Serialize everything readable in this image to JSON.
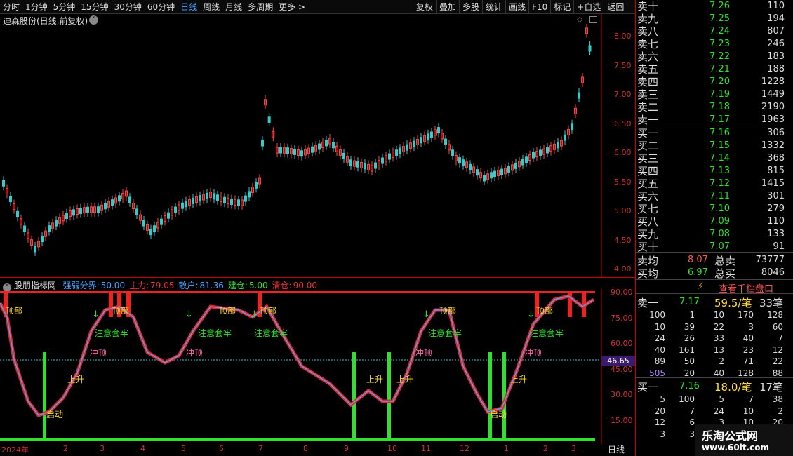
{
  "toolbar": {
    "periods": [
      "分时",
      "1分钟",
      "5分钟",
      "15分钟",
      "30分钟",
      "60分钟",
      "日线",
      "周线",
      "月线",
      "多周期",
      "更多 >"
    ],
    "active": "日线",
    "right": [
      "复权",
      "叠加",
      "多股",
      "统计",
      "画线",
      "F10",
      "标记",
      "+自选",
      "返回"
    ]
  },
  "main_title": "迪森股份(日线,前复权)",
  "price_axis": [
    "8.00",
    "7.50",
    "7.00",
    "6.50",
    "6.00",
    "5.50",
    "5.00",
    "4.50",
    "4.00"
  ],
  "indicator": {
    "name": "股朋指标网",
    "items": [
      {
        "k": "强弱分界:",
        "v": "50.00",
        "c": "#4aa3ff"
      },
      {
        "k": "主力:",
        "v": "79.05",
        "c": "#e33"
      },
      {
        "k": "散户:",
        "v": "81.36",
        "c": "#4aa3ff"
      },
      {
        "k": "建仓:",
        "v": "5.00",
        "c": "#2fe02f"
      },
      {
        "k": "清仓:",
        "v": "90.00",
        "c": "#e33"
      }
    ],
    "axis": [
      "90.00",
      "75.00",
      "60.00",
      "45.00",
      "30.00",
      "15.00"
    ],
    "cur": "46.65",
    "labels": {
      "top": "顶部",
      "attn": "注意套牢",
      "chong": "冲顶",
      "rise": "上升",
      "start": "启动"
    }
  },
  "dates": [
    "2024年",
    "2",
    "3",
    "4",
    "5",
    "6",
    "7",
    "8",
    "9",
    "10",
    "11",
    "12",
    "1",
    "2",
    "3"
  ],
  "period_label": "日线",
  "order_book": {
    "sells": [
      [
        "卖十",
        "7.26",
        "110"
      ],
      [
        "卖九",
        "7.25",
        "194"
      ],
      [
        "卖八",
        "7.24",
        "807"
      ],
      [
        "卖七",
        "7.23",
        "246"
      ],
      [
        "卖六",
        "7.22",
        "183"
      ],
      [
        "卖五",
        "7.21",
        "188"
      ],
      [
        "卖四",
        "7.20",
        "1228"
      ],
      [
        "卖三",
        "7.19",
        "1449"
      ],
      [
        "卖二",
        "7.18",
        "2190"
      ],
      [
        "卖一",
        "7.17",
        "1963"
      ]
    ],
    "buys": [
      [
        "买一",
        "7.16",
        "306"
      ],
      [
        "买二",
        "7.15",
        "1332"
      ],
      [
        "买三",
        "7.14",
        "368"
      ],
      [
        "买四",
        "7.13",
        "815"
      ],
      [
        "买五",
        "7.12",
        "1415"
      ],
      [
        "买六",
        "7.11",
        "301"
      ],
      [
        "买七",
        "7.10",
        "279"
      ],
      [
        "买八",
        "7.09",
        "110"
      ],
      [
        "买九",
        "7.08",
        "133"
      ],
      [
        "买十",
        "7.07",
        "91"
      ]
    ],
    "avg_sell_label": "卖均",
    "avg_sell": "8.07",
    "total_sell_label": "总卖",
    "total_sell": "73777",
    "avg_buy_label": "买均",
    "avg_buy": "6.97",
    "total_buy_label": "总买",
    "total_buy": "8046"
  },
  "thousand_btn": "查看千档盘口",
  "ask1": {
    "label": "卖一",
    "price": "7.17",
    "size": "59.5/笔",
    "count": "33笔",
    "rows": [
      [
        "100",
        "1",
        "10",
        "170",
        "128"
      ],
      [
        "10",
        "39",
        "22",
        "3",
        "60"
      ],
      [
        "24",
        "26",
        "33",
        "40",
        "7"
      ],
      [
        "40",
        "161",
        "13",
        "23",
        "12"
      ],
      [
        "89",
        "50",
        "2",
        "71",
        "22"
      ],
      [
        "505",
        "20",
        "40",
        "128",
        "88"
      ]
    ]
  },
  "bid1": {
    "label": "买一",
    "price": "7.16",
    "size": "18.0/笔",
    "count": "17笔",
    "rows": [
      [
        "5",
        "100",
        "5",
        "7",
        "38"
      ],
      [
        "20",
        "7",
        "24",
        "10",
        "2"
      ],
      [
        "12",
        "6",
        "3",
        "10",
        "20"
      ],
      [
        "3",
        "3",
        "",
        "",
        ""
      ]
    ]
  },
  "watermark": {
    "title": "乐淘公式网",
    "url": "www.60lt.com"
  }
}
